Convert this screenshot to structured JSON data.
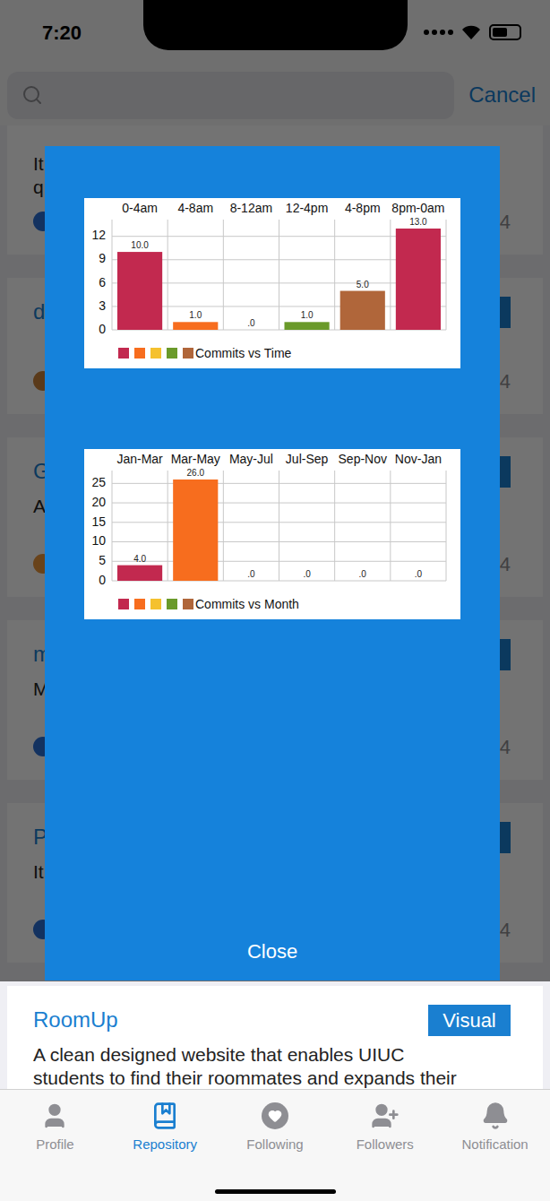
{
  "status_bar": {
    "time": "7:20"
  },
  "search": {
    "cancel": "Cancel"
  },
  "repositories": [
    {
      "description": [
        "It is a django website that enables UIUC students to",
        "q"
      ],
      "count": "4",
      "avatar_color": "#2a6fd6"
    },
    {
      "title": "d",
      "button": "",
      "description": [],
      "count": "4",
      "avatar_color": "#c8823a"
    },
    {
      "title": "G",
      "button": "",
      "description": [
        "A"
      ],
      "count": "4",
      "avatar_color": "#e8943a"
    },
    {
      "title": "m",
      "button": "",
      "description": [
        "M"
      ],
      "count": "4",
      "avatar_color": "#2a6fd6"
    },
    {
      "title": "P",
      "button": "",
      "description": [
        "It"
      ],
      "count": "4",
      "avatar_color": "#2a6fd6"
    },
    {
      "title": "RoomUp",
      "button": "Visual",
      "description": [
        "A clean designed website that enables UIUC",
        "students to find their roommates and expands their"
      ],
      "count": "",
      "avatar_color": "#2a6fd6"
    }
  ],
  "modal": {
    "charts": [
      {
        "categories": [
          "0-4am",
          "4-8am",
          "8-12am",
          "12-4pm",
          "4-8pm",
          "8pm-0am"
        ],
        "ticks": [
          "12",
          "9",
          "6",
          "3",
          "0"
        ],
        "values": [
          10,
          1,
          0,
          1,
          5,
          13
        ],
        "value_labels": [
          "10.0",
          "1.0",
          ".0",
          "1.0",
          "5.0",
          "13.0"
        ],
        "legend": "Commits vs Time",
        "colors": [
          "#c2294f",
          "#f76d1e",
          "#f5c12e",
          "#6a9a2a",
          "#b0663a"
        ]
      },
      {
        "categories": [
          "Jan-Mar",
          "Mar-May",
          "May-Jul",
          "Jul-Sep",
          "Sep-Nov",
          "Nov-Jan"
        ],
        "ticks": [
          "25",
          "20",
          "15",
          "10",
          "5",
          "0"
        ],
        "values": [
          4,
          26,
          0,
          0,
          0,
          0
        ],
        "value_labels": [
          "4.0",
          "26.0",
          ".0",
          ".0",
          ".0",
          ".0"
        ],
        "legend": "Commits vs Month",
        "colors": [
          "#c2294f",
          "#f76d1e",
          "#f5c12e",
          "#6a9a2a",
          "#b0663a"
        ]
      }
    ],
    "close": "Close"
  },
  "tab_bar": [
    {
      "label": "Profile",
      "selected": false
    },
    {
      "label": "Repository",
      "selected": true
    },
    {
      "label": "Following",
      "selected": false
    },
    {
      "label": "Followers",
      "selected": false
    },
    {
      "label": "Notification",
      "selected": false
    }
  ]
}
